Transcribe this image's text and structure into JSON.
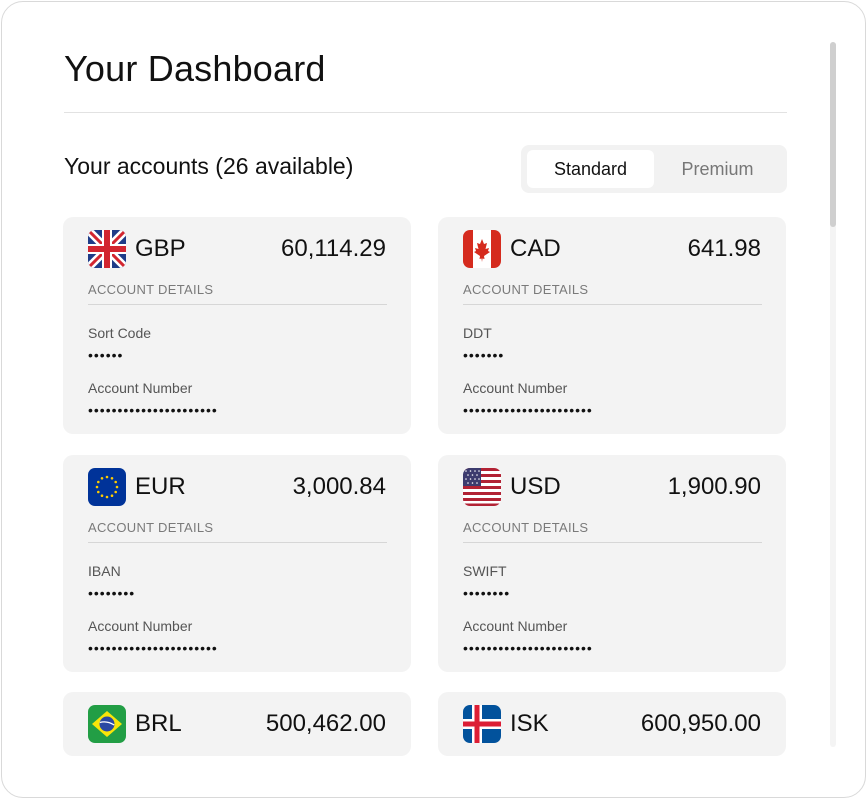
{
  "title": "Your Dashboard",
  "accounts_heading": "Your accounts (26 available)",
  "toggle": {
    "standard": "Standard",
    "premium": "Premium",
    "selected": "Standard"
  },
  "cards": [
    {
      "currency": "GBP",
      "balance": "60,114.29",
      "flag": "uk-flag-icon",
      "details": "ACCOUNT DETAILS",
      "field1_label": "Sort Code",
      "field1_value": "••••••",
      "field2_label": "Account Number",
      "field2_value": "••••••••••••••••••••••"
    },
    {
      "currency": "CAD",
      "balance": "641.98",
      "flag": "canada-flag-icon",
      "details": "ACCOUNT DETAILS",
      "field1_label": "DDT",
      "field1_value": "•••••••",
      "field2_label": "Account Number",
      "field2_value": "••••••••••••••••••••••"
    },
    {
      "currency": "EUR",
      "balance": "3,000.84",
      "flag": "eu-flag-icon",
      "details": "ACCOUNT DETAILS",
      "field1_label": "IBAN",
      "field1_value": "••••••••",
      "field2_label": "Account Number",
      "field2_value": "••••••••••••••••••••••"
    },
    {
      "currency": "USD",
      "balance": "1,900.90",
      "flag": "us-flag-icon",
      "details": "ACCOUNT DETAILS",
      "field1_label": "SWIFT",
      "field1_value": "••••••••",
      "field2_label": "Account Number",
      "field2_value": "••••••••••••••••••••••"
    },
    {
      "currency": "BRL",
      "balance": "500,462.00",
      "flag": "brazil-flag-icon"
    },
    {
      "currency": "ISK",
      "balance": "600,950.00",
      "flag": "iceland-flag-icon"
    }
  ]
}
